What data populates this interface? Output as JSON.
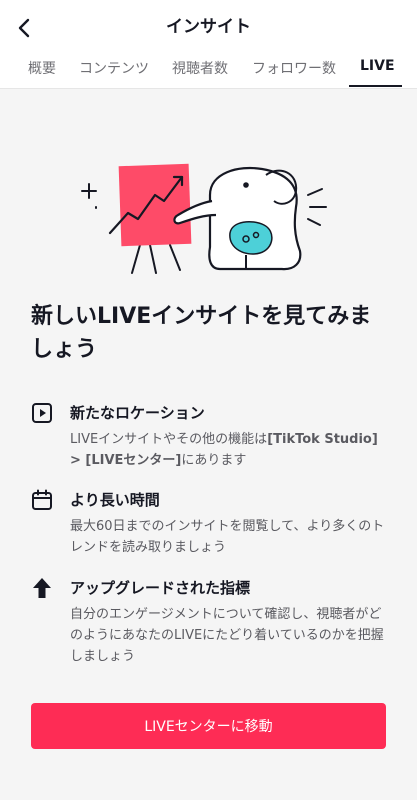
{
  "header": {
    "title": "インサイト"
  },
  "tabs": [
    {
      "label": "概要"
    },
    {
      "label": "コンテンツ"
    },
    {
      "label": "視聴者数"
    },
    {
      "label": "フォロワー数"
    },
    {
      "label": "LIVE"
    }
  ],
  "active_tab": "LIVE",
  "main": {
    "headline": "新しいLIVEインサイトを見てみましょう",
    "features": [
      {
        "icon": "play-square-icon",
        "title": "新たなロケーション",
        "desc_prefix": "LIVEインサイトやその他の機能は",
        "desc_bold_1": "[TikTok Studio] > [LIVEセンター]",
        "desc_suffix": "にあります"
      },
      {
        "icon": "calendar-icon",
        "title": "より長い時間",
        "desc": "最大60日までのインサイトを閲覧して、より多くのトレンドを読み取りましょう"
      },
      {
        "icon": "arrow-up-icon",
        "title": "アップグレードされた指標",
        "desc": "自分のエンゲージメントについて確認し、視聴者がどのようにあなたのLIVEにたどり着いているのかを把握しましょう"
      }
    ],
    "cta_label": "LIVEセンターに移動"
  },
  "colors": {
    "accent": "#fe2c55",
    "teal": "#4dd0d8",
    "text": "#161823"
  }
}
